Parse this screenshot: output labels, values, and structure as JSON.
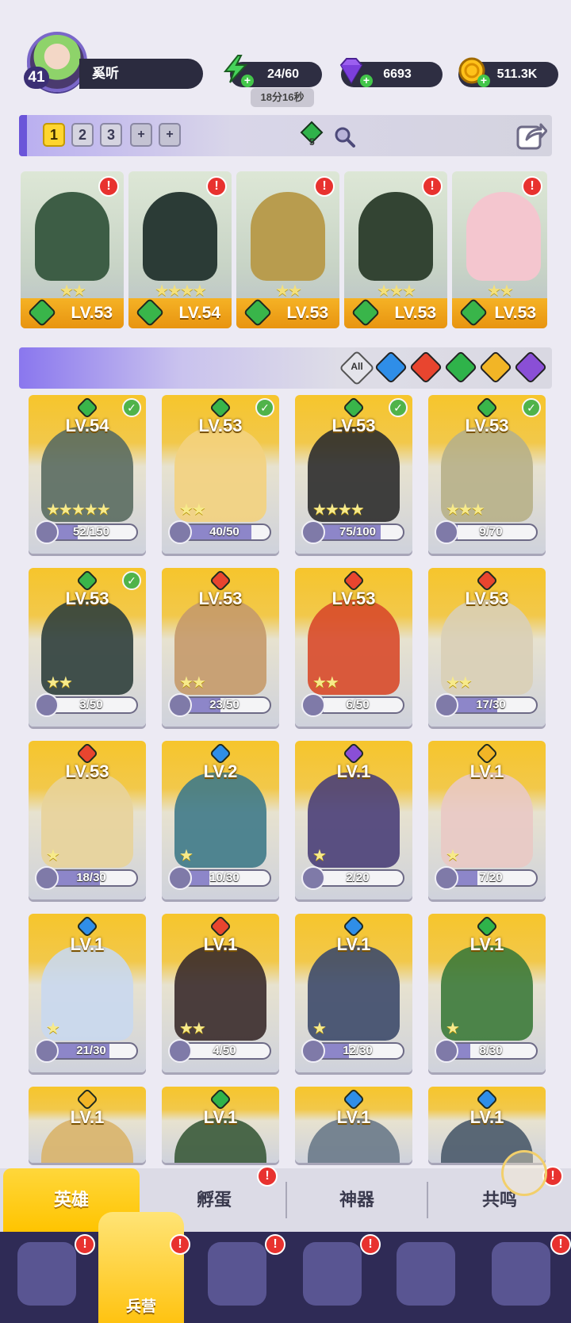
{
  "player": {
    "level": "41",
    "name": "奚听"
  },
  "resources": {
    "energy": "24/60",
    "energy_timer": "18分16秒",
    "gems": "6693",
    "gold": "511.3K"
  },
  "teams": {
    "tabs": [
      "1",
      "2",
      "3",
      "+",
      "+"
    ],
    "active": "1",
    "gem_count": "5"
  },
  "team_heroes": [
    {
      "level": "LV.53",
      "stars": "★★",
      "element": "green"
    },
    {
      "level": "LV.54",
      "stars": "★★★★",
      "element": "green"
    },
    {
      "level": "LV.53",
      "stars": "★★",
      "element": "green"
    },
    {
      "level": "LV.53",
      "stars": "★★★",
      "element": "green"
    },
    {
      "level": "LV.53",
      "stars": "★★",
      "element": "green"
    }
  ],
  "filters": {
    "all_label": "All",
    "elements": [
      "water",
      "fire",
      "wood",
      "light",
      "dark"
    ]
  },
  "heroes": [
    {
      "level": "LV.54",
      "shards": "52/150",
      "fill": 0.35,
      "stars": "★★★★★",
      "element": "green",
      "checked": true
    },
    {
      "level": "LV.53",
      "shards": "40/50",
      "fill": 0.8,
      "stars": "★★",
      "element": "green",
      "checked": true
    },
    {
      "level": "LV.53",
      "shards": "75/100",
      "fill": 0.75,
      "stars": "★★★★",
      "element": "green",
      "checked": true
    },
    {
      "level": "LV.53",
      "shards": "9/70",
      "fill": 0.13,
      "stars": "★★★",
      "element": "green",
      "checked": true
    },
    {
      "level": "LV.53",
      "shards": "3/50",
      "fill": 0.06,
      "stars": "★★",
      "element": "green",
      "checked": true
    },
    {
      "level": "LV.53",
      "shards": "23/50",
      "fill": 0.46,
      "stars": "★★",
      "element": "fire",
      "checked": false
    },
    {
      "level": "LV.53",
      "shards": "6/50",
      "fill": 0.12,
      "stars": "★★",
      "element": "fire",
      "checked": false
    },
    {
      "level": "LV.53",
      "shards": "17/30",
      "fill": 0.57,
      "stars": "★★",
      "element": "fire",
      "checked": false
    },
    {
      "level": "LV.53",
      "shards": "18/30",
      "fill": 0.6,
      "stars": "★",
      "element": "fire",
      "checked": false
    },
    {
      "level": "LV.2",
      "shards": "10/30",
      "fill": 0.33,
      "stars": "★",
      "element": "water",
      "checked": false
    },
    {
      "level": "LV.1",
      "shards": "2/20",
      "fill": 0.1,
      "stars": "★",
      "element": "dark",
      "checked": false
    },
    {
      "level": "LV.1",
      "shards": "7/20",
      "fill": 0.35,
      "stars": "★",
      "element": "light",
      "checked": false
    },
    {
      "level": "LV.1",
      "shards": "21/30",
      "fill": 0.7,
      "stars": "★",
      "element": "water",
      "checked": false
    },
    {
      "level": "LV.1",
      "shards": "4/50",
      "fill": 0.08,
      "stars": "★★",
      "element": "fire",
      "checked": false
    },
    {
      "level": "LV.1",
      "shards": "12/30",
      "fill": 0.4,
      "stars": "★",
      "element": "water",
      "checked": false
    },
    {
      "level": "LV.1",
      "shards": "8/30",
      "fill": 0.27,
      "stars": "★",
      "element": "wood",
      "checked": false
    },
    {
      "level": "LV.1",
      "element": "light"
    },
    {
      "level": "LV.1",
      "element": "wood"
    },
    {
      "level": "LV.1",
      "element": "water"
    },
    {
      "level": "LV.1",
      "element": "water"
    }
  ],
  "sub_tabs": [
    "英雄",
    "孵蛋",
    "神器",
    "共鸣"
  ],
  "nav": {
    "active_label": "兵营"
  },
  "colors": {
    "green": "#39b54a",
    "fire": "#e8452f",
    "water": "#2f8ee8",
    "wood": "#2fb34a",
    "light": "#f2b526",
    "dark": "#8a4fd6"
  }
}
